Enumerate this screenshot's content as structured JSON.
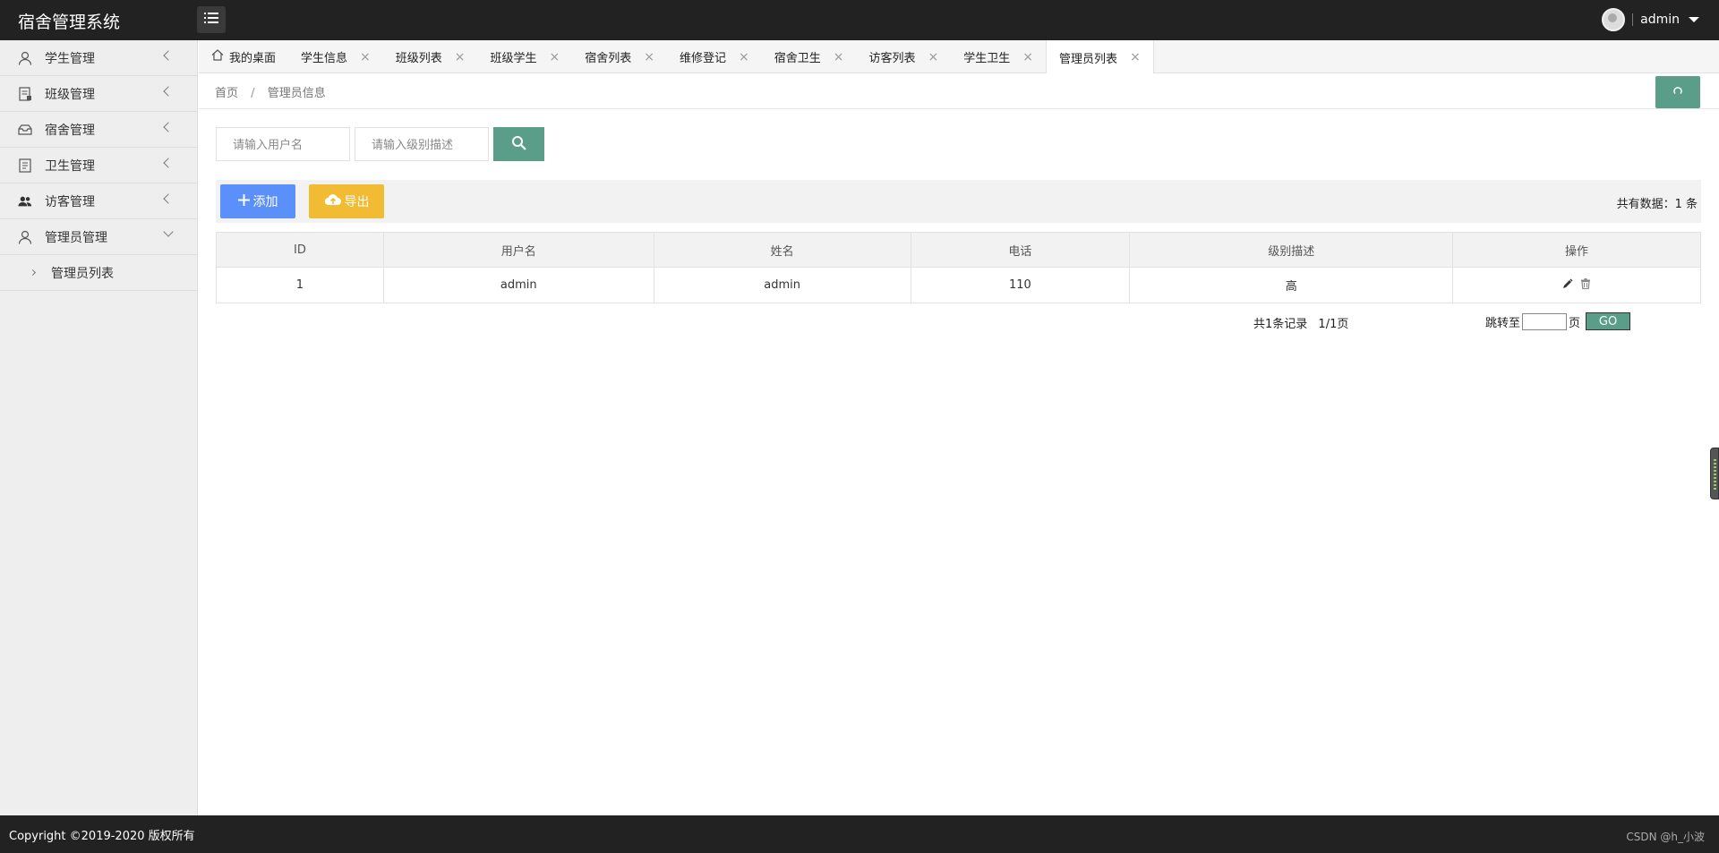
{
  "app": {
    "title": "宿舍管理系统"
  },
  "user": {
    "name": "admin"
  },
  "sidebar": {
    "items": [
      {
        "label": "学生管理",
        "icon": "user-icon"
      },
      {
        "label": "班级管理",
        "icon": "class-icon"
      },
      {
        "label": "宿舍管理",
        "icon": "dorm-icon"
      },
      {
        "label": "卫生管理",
        "icon": "hygiene-icon"
      },
      {
        "label": "访客管理",
        "icon": "visitors-icon"
      },
      {
        "label": "管理员管理",
        "icon": "admin-icon",
        "expanded": true,
        "children": [
          {
            "label": "管理员列表"
          }
        ]
      }
    ]
  },
  "tabs": [
    {
      "label": "我的桌面",
      "closable": false,
      "icon": "home-icon"
    },
    {
      "label": "学生信息",
      "closable": true
    },
    {
      "label": "班级列表",
      "closable": true
    },
    {
      "label": "班级学生",
      "closable": true
    },
    {
      "label": "宿舍列表",
      "closable": true
    },
    {
      "label": "维修登记",
      "closable": true
    },
    {
      "label": "宿舍卫生",
      "closable": true
    },
    {
      "label": "访客列表",
      "closable": true
    },
    {
      "label": "学生卫生",
      "closable": true
    },
    {
      "label": "管理员列表",
      "closable": true,
      "active": true
    }
  ],
  "tab_close_glyph": "×",
  "breadcrumb": {
    "home": "首页",
    "separator": "/",
    "current": "管理员信息"
  },
  "search": {
    "username_placeholder": "请输入用户名",
    "level_placeholder": "请输入级别描述"
  },
  "toolbar": {
    "add_label": "添加",
    "export_label": "导出",
    "total_text": "共有数据：1 条"
  },
  "table": {
    "headers": [
      "ID",
      "用户名",
      "姓名",
      "电话",
      "级别描述",
      "操作"
    ],
    "rows": [
      {
        "id": "1",
        "username": "admin",
        "name": "admin",
        "phone": "110",
        "level": "高"
      }
    ]
  },
  "pagination": {
    "records_text": "共1条记录",
    "pages_text": "1/1页",
    "jump_label": "跳转至",
    "page_suffix": "页",
    "go_label": "GO"
  },
  "footer": {
    "copyright": "Copyright ©2019-2020 版权所有",
    "watermark": "CSDN @h_小波"
  },
  "colors": {
    "header_bg": "#222222",
    "primary_green": "#5a9e8a",
    "add_blue": "#5b8ff9",
    "export_yellow": "#f1bb34"
  }
}
